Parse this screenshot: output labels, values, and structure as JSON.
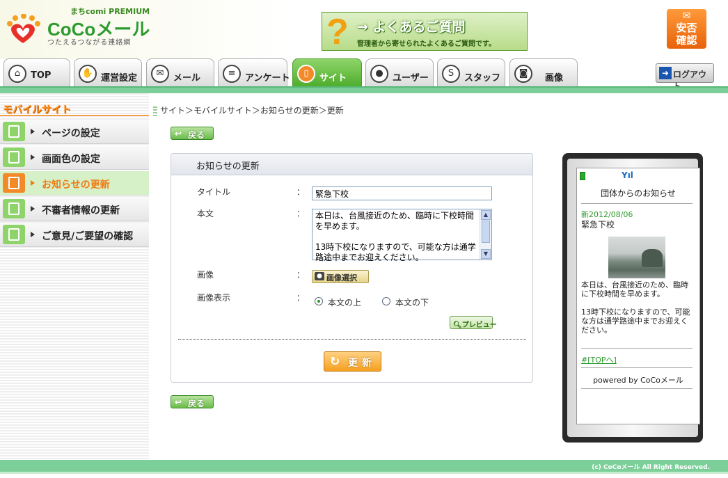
{
  "header": {
    "logo_premium": "まちcomi PREMIUM",
    "logo_brand": "CoCoメール",
    "logo_tagline": "つたえるつながる連絡網",
    "faq_title": "→ よくあるご質問",
    "faq_sub": "管理者から寄せられたよくあるご質問です。",
    "anpi_label": "安否確認",
    "logout_label": "ログアウト"
  },
  "tabs": [
    {
      "label": "TOP"
    },
    {
      "label": "運営設定"
    },
    {
      "label": "メール"
    },
    {
      "label": "アンケート"
    },
    {
      "label": "サイト"
    },
    {
      "label": "ユーザー"
    },
    {
      "label": "スタッフ"
    },
    {
      "label": "画像"
    }
  ],
  "sidebar": {
    "title": "モバイルサイト",
    "items": [
      {
        "label": "ページの設定"
      },
      {
        "label": "画面色の設定"
      },
      {
        "label": "お知らせの更新"
      },
      {
        "label": "不審者情報の更新"
      },
      {
        "label": "ご意見/ご要望の確認"
      }
    ]
  },
  "breadcrumb": "サイト＞モバイルサイト＞お知らせの更新＞更新",
  "back_label": "戻る",
  "form": {
    "heading": "お知らせの更新",
    "title_label": "タイトル",
    "title_value": "緊急下校",
    "body_label": "本文",
    "body_value": "本日は、台風接近のため、臨時に下校時間を早めます。\n\n13時下校になりますので、可能な方は通学路途中までお迎えください。",
    "image_label": "画像",
    "image_select": "画像選択",
    "display_label": "画像表示",
    "colon": "：",
    "radio_above": "本文の上",
    "radio_below": "本文の下",
    "preview": "プレビュー",
    "update": "更新"
  },
  "phone": {
    "title": "団体からのお知らせ",
    "date": "新2012/08/06",
    "msg_title": "緊急下校",
    "msg_body": "本日は、台風接近のため、臨時に下校時間を早めます。\n\n13時下校になりますので、可能な方は通学路途中までお迎えください。",
    "top_link": "#[TOPへ]",
    "powered": "powered by CoCoメール"
  },
  "footer": "(c) CoCoメール All Right Reserved."
}
